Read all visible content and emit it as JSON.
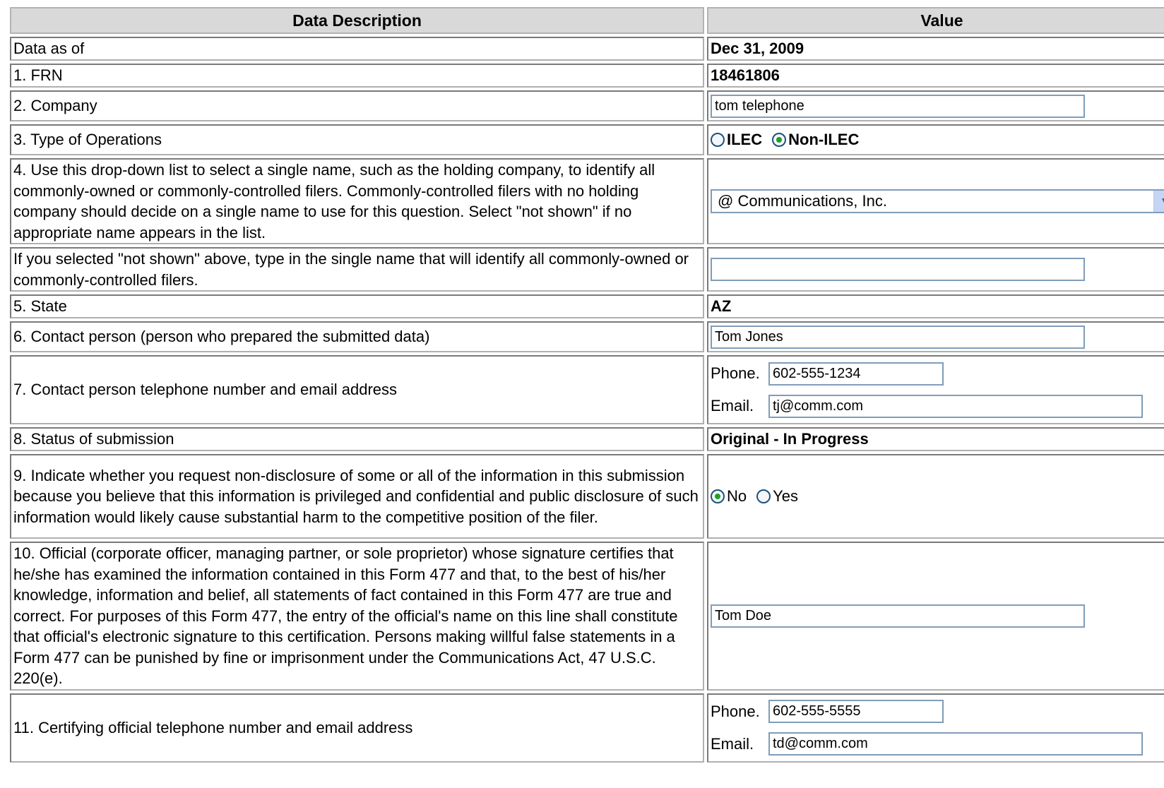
{
  "headers": {
    "description": "Data Description",
    "value": "Value"
  },
  "rows": {
    "data_as_of": {
      "label": "Data as of",
      "value": "Dec 31, 2009"
    },
    "frn": {
      "label": "1. FRN",
      "value": "18461806"
    },
    "company": {
      "label": "2. Company",
      "value": "tom telephone"
    },
    "operations": {
      "label": "3. Type of Operations",
      "options": [
        "ILEC",
        "Non-ILEC"
      ],
      "selected": "Non-ILEC"
    },
    "holding": {
      "label": "4. Use this drop-down list to select a single name, such as the holding company, to identify all commonly-owned or commonly-controlled filers. Commonly-controlled filers with no holding company should decide on a single name to use for this question. Select \"not shown\" if no appropriate name appears in the list.",
      "selected": "@ Communications, Inc.",
      "icon": "chevron-down-icon"
    },
    "not_shown": {
      "label": "If you selected \"not shown\" above, type in the single name that will identify all commonly-owned or commonly-controlled filers.",
      "value": ""
    },
    "state": {
      "label": "5. State",
      "value": "AZ"
    },
    "contact": {
      "label": "6. Contact person (person who prepared the submitted data)",
      "value": "Tom Jones"
    },
    "contact_phone_email": {
      "label": "7. Contact person telephone number and email address",
      "phone_label": "Phone.",
      "phone": "602-555-1234",
      "email_label": "Email.",
      "email": "tj@comm.com"
    },
    "status": {
      "label": "8. Status of submission",
      "value": "Original - In Progress"
    },
    "nondisclosure": {
      "label": "9. Indicate whether you request non-disclosure of some or all of the information in this submission because you believe that this information is privileged and confidential and public disclosure of such information would likely cause substantial harm to the competitive position of the filer.",
      "options": [
        "No",
        "Yes"
      ],
      "selected": "No"
    },
    "official": {
      "label": "10. Official (corporate officer, managing partner, or sole proprietor) whose signature certifies that he/she has examined the information contained in this Form 477 and that, to the best of his/her knowledge, information and belief, all statements of fact contained in this Form 477 are true and correct. For purposes of this Form 477, the entry of the official's name on this line shall constitute that official's electronic signature to this certification. Persons making willful false statements in a Form 477 can be punished by fine or imprisonment under the Communications Act, 47 U.S.C. 220(e).",
      "value": "Tom Doe"
    },
    "official_phone_email": {
      "label": "11. Certifying official telephone number and email address",
      "phone_label": "Phone.",
      "phone": "602-555-5555",
      "email_label": "Email.",
      "email": "td@comm.com"
    }
  },
  "colors": {
    "header_bg": "#d9d9d9",
    "input_border": "#7f9db9",
    "radio_dot": "#21a121"
  }
}
